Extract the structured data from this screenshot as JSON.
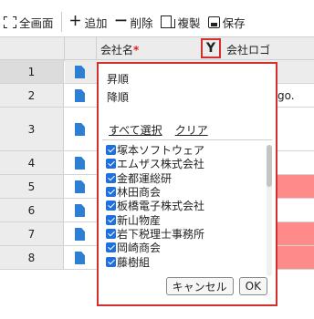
{
  "toolbar": {
    "fullscreen_label": "全画面",
    "add_label": "追加",
    "delete_label": "削除",
    "copy_label": "複製",
    "save_label": "保存"
  },
  "grid": {
    "columns": {
      "company_name": "会社名",
      "required_mark": "*",
      "company_logo": "会社ロゴ"
    },
    "rows": [
      {
        "num": "1"
      },
      {
        "num": "2",
        "logo_text": "go."
      },
      {
        "num": "3"
      },
      {
        "num": "4"
      },
      {
        "num": "5"
      },
      {
        "num": "6"
      },
      {
        "num": "7"
      },
      {
        "num": "8"
      }
    ],
    "filter_icon": "filter-icon",
    "document_icon": "document-icon",
    "highlight_color": "#ff8a8a"
  },
  "filter_panel": {
    "sort_asc": "昇順",
    "sort_desc": "降順",
    "select_all": "すべて選択",
    "clear": "クリア",
    "items": [
      "塚本ソフトウェア",
      "エムザス株式会社",
      "金都運総研",
      "林田商会",
      "板橋電子株式会社",
      "新山物産",
      "岩下税理士事務所",
      "岡崎商会",
      "藤樹組"
    ],
    "cancel_label": "キャンセル",
    "ok_label": "OK",
    "accent_color": "#d32f2f"
  }
}
